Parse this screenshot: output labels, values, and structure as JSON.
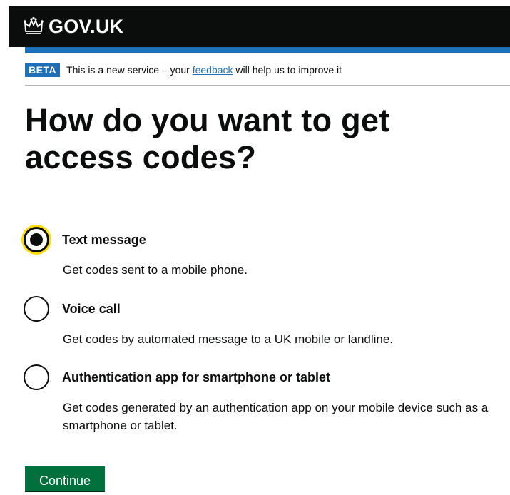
{
  "header": {
    "logo_text": "GOV.UK",
    "logo_icon": "crown-icon"
  },
  "phase_banner": {
    "tag": "BETA",
    "text_before": "This is a new service – your",
    "link": "feedback",
    "text_after": "will help us to improve it"
  },
  "page": {
    "title": "How do you want to get access codes?",
    "options": [
      {
        "label": "Text message",
        "hint": "Get codes sent to a mobile phone.",
        "checked": true
      },
      {
        "label": "Voice call",
        "hint": "Get codes by automated message to a UK mobile or landline.",
        "checked": false
      },
      {
        "label": "Authentication app for smartphone or tablet",
        "hint": "Get codes generated by an authentication app on your mobile device such as a smartphone or tablet.",
        "checked": false
      }
    ],
    "continue_label": "Continue"
  },
  "colors": {
    "header_bg": "#0b0c0c",
    "brand_blue": "#1d70b8",
    "focus_yellow": "#ffdd00",
    "button_green": "#00703c"
  }
}
